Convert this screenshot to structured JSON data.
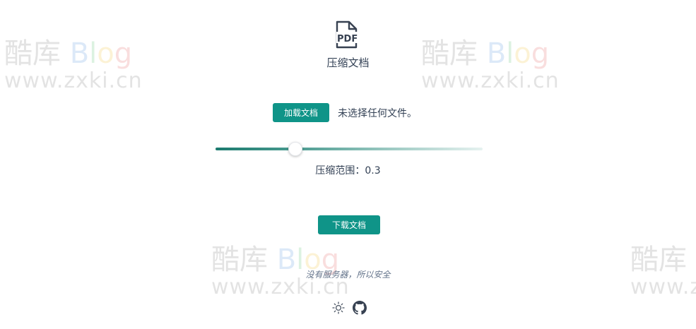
{
  "watermark": {
    "brand_cn": "酷库",
    "brand_b": "B",
    "brand_l": "l",
    "brand_o": "o",
    "brand_g": "g",
    "url": "www.zxki.cn"
  },
  "app": {
    "icon": "pdf-file-icon",
    "icon_text": "PDF",
    "title": "压缩文档"
  },
  "upload": {
    "button_label": "加载文档",
    "status_text": "未选择任何文件。"
  },
  "compression": {
    "value": 0.3,
    "label": "压缩范围：0.3"
  },
  "download": {
    "button_label": "下载文档"
  },
  "footer": {
    "note": "没有服务器，所以安全",
    "icons": [
      "sun-icon",
      "github-icon"
    ]
  },
  "colors": {
    "accent": "#0f9488",
    "text": "#334155",
    "muted": "#64748b"
  }
}
